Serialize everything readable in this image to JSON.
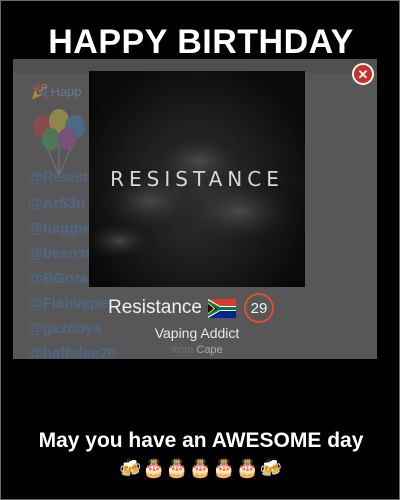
{
  "header": {
    "title": "HAPPY BIRTHDAY"
  },
  "background_panel": {
    "heading_partial": "Happ",
    "handles": [
      "@Resist",
      "@Ar53n",
      "@baggie",
      "@beenst",
      "@BGora",
      "@Fishvape",
      "@gazcoys",
      "@haffalee20"
    ]
  },
  "popup": {
    "logo_text": "RESISTANCE",
    "name": "Resistance",
    "age": "29",
    "title": "Vaping Addict",
    "from_label": "from",
    "city": "Cape"
  },
  "footer": {
    "message": "May you have an AWESOME day",
    "emojis": "🍻🎂🎂🎂🎂🎂🍻"
  },
  "colors": {
    "accent_badge": "#d9502d",
    "close_button": "#c8302b",
    "handle_link": "#4f6787"
  },
  "icons": [
    "close-icon",
    "south-africa-flag-icon",
    "balloons-icon",
    "beer-mugs-icon",
    "birthday-cake-icon"
  ]
}
